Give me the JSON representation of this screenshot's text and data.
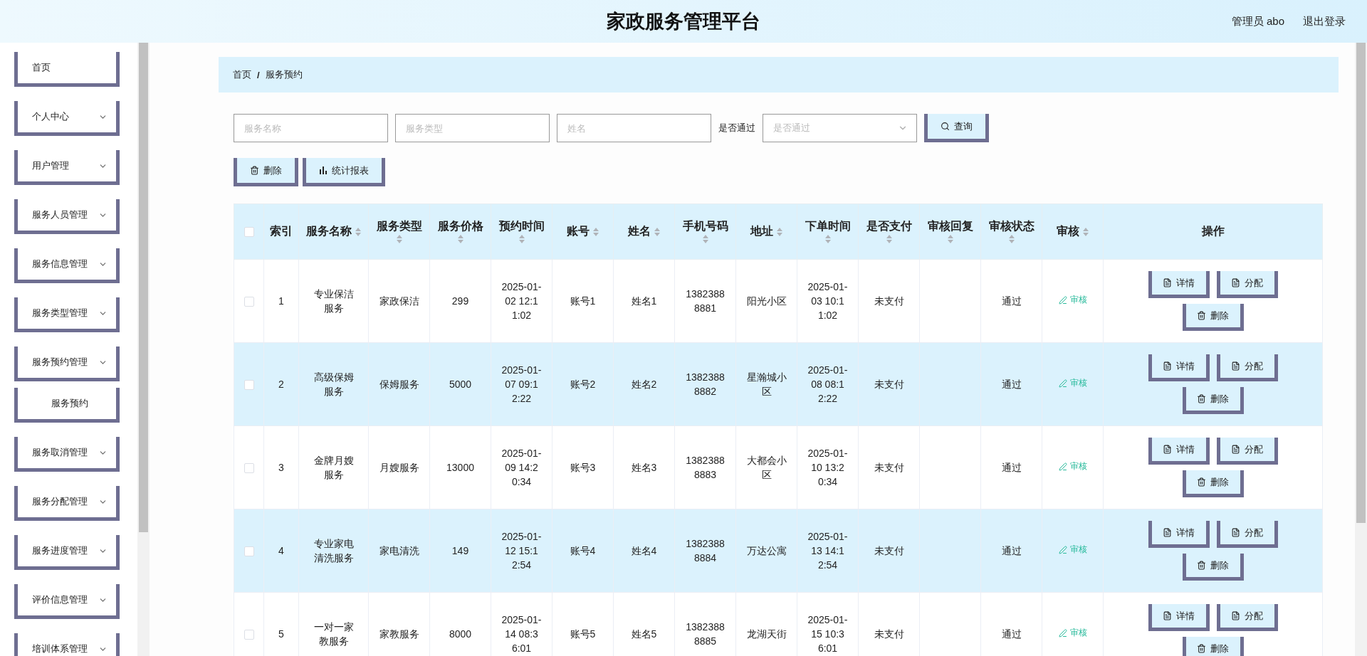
{
  "header": {
    "title": "家政服务管理平台",
    "user": "管理员 abo",
    "logout": "退出登录"
  },
  "sidebar": {
    "items": [
      {
        "label": "首页",
        "expandable": false
      },
      {
        "label": "个人中心",
        "expandable": true
      },
      {
        "label": "用户管理",
        "expandable": true
      },
      {
        "label": "服务人员管理",
        "expandable": true
      },
      {
        "label": "服务信息管理",
        "expandable": true
      },
      {
        "label": "服务类型管理",
        "expandable": true
      },
      {
        "label": "服务预约管理",
        "expandable": true,
        "children": [
          {
            "label": "服务预约"
          }
        ]
      },
      {
        "label": "服务取消管理",
        "expandable": true
      },
      {
        "label": "服务分配管理",
        "expandable": true
      },
      {
        "label": "服务进度管理",
        "expandable": true
      },
      {
        "label": "评价信息管理",
        "expandable": true
      },
      {
        "label": "培训体系管理",
        "expandable": true
      }
    ]
  },
  "breadcrumb": {
    "items": [
      "首页",
      "服务预约"
    ],
    "separator": "/"
  },
  "search": {
    "fields": [
      {
        "placeholder": "服务名称"
      },
      {
        "placeholder": "服务类型"
      },
      {
        "placeholder": "姓名"
      }
    ],
    "select_label": "是否通过",
    "select_placeholder": "是否通过",
    "button": "查询"
  },
  "toolbar": [
    {
      "label": "删除",
      "kind": "delete"
    },
    {
      "label": "统计报表",
      "kind": "chart"
    }
  ],
  "table": {
    "select_all": false,
    "columns": [
      {
        "label": "索引",
        "sortable": false
      },
      {
        "label": "服务名称",
        "sortable": true
      },
      {
        "label": "服务类型",
        "sortable": true
      },
      {
        "label": "服务价格",
        "sortable": true
      },
      {
        "label": "预约时间",
        "sortable": true
      },
      {
        "label": "账号",
        "sortable": true
      },
      {
        "label": "姓名",
        "sortable": true
      },
      {
        "label": "手机号码",
        "sortable": true
      },
      {
        "label": "地址",
        "sortable": true
      },
      {
        "label": "下单时间",
        "sortable": true
      },
      {
        "label": "是否支付",
        "sortable": true
      },
      {
        "label": "审核回复",
        "sortable": true
      },
      {
        "label": "审核状态",
        "sortable": true
      },
      {
        "label": "审核",
        "sortable": true
      },
      {
        "label": "操作",
        "sortable": false
      }
    ],
    "rows": [
      {
        "checked": false,
        "cells": [
          "1",
          "专业保洁服务",
          "家政保洁",
          "299",
          "2025-01-02 12:11:02",
          "账号1",
          "姓名1",
          "13823888881",
          "阳光小区",
          "2025-01-03 10:11:02",
          "未支付",
          null,
          "通过"
        ],
        "review": "审核",
        "actions": [
          {
            "label": "详情",
            "kind": "doc"
          },
          {
            "label": "分配",
            "kind": "doc"
          },
          {
            "label": "删除",
            "kind": "delete"
          }
        ]
      },
      {
        "checked": false,
        "cells": [
          "2",
          "高级保姆服务",
          "保姆服务",
          "5000",
          "2025-01-07 09:12:22",
          "账号2",
          "姓名2",
          "13823888882",
          "星瀚城小区",
          "2025-01-08 08:12:22",
          "未支付",
          null,
          "通过"
        ],
        "review": "审核",
        "actions": [
          {
            "label": "详情",
            "kind": "doc"
          },
          {
            "label": "分配",
            "kind": "doc"
          },
          {
            "label": "删除",
            "kind": "delete"
          }
        ]
      },
      {
        "checked": false,
        "cells": [
          "3",
          "金牌月嫂服务",
          "月嫂服务",
          "13000",
          "2025-01-09 14:20:34",
          "账号3",
          "姓名3",
          "13823888883",
          "大都会小区",
          "2025-01-10 13:20:34",
          "未支付",
          null,
          "通过"
        ],
        "review": "审核",
        "actions": [
          {
            "label": "详情",
            "kind": "doc"
          },
          {
            "label": "分配",
            "kind": "doc"
          },
          {
            "label": "删除",
            "kind": "delete"
          }
        ]
      },
      {
        "checked": false,
        "cells": [
          "4",
          "专业家电清洗服务",
          "家电清洗",
          "149",
          "2025-01-12 15:12:54",
          "账号4",
          "姓名4",
          "13823888884",
          "万达公寓",
          "2025-01-13 14:12:54",
          "未支付",
          null,
          "通过"
        ],
        "review": "审核",
        "actions": [
          {
            "label": "详情",
            "kind": "doc"
          },
          {
            "label": "分配",
            "kind": "doc"
          },
          {
            "label": "删除",
            "kind": "delete"
          }
        ]
      },
      {
        "checked": false,
        "cells": [
          "5",
          "一对一家教服务",
          "家教服务",
          "8000",
          "2025-01-14 08:36:01",
          "账号5",
          "姓名5",
          "13823888885",
          "龙湖天街",
          "2025-01-15 10:36:01",
          "未支付",
          null,
          "通过"
        ],
        "review": "审核",
        "actions": [
          {
            "label": "详情",
            "kind": "doc"
          },
          {
            "label": "分配",
            "kind": "doc"
          },
          {
            "label": "删除",
            "kind": "delete"
          }
        ]
      }
    ]
  }
}
